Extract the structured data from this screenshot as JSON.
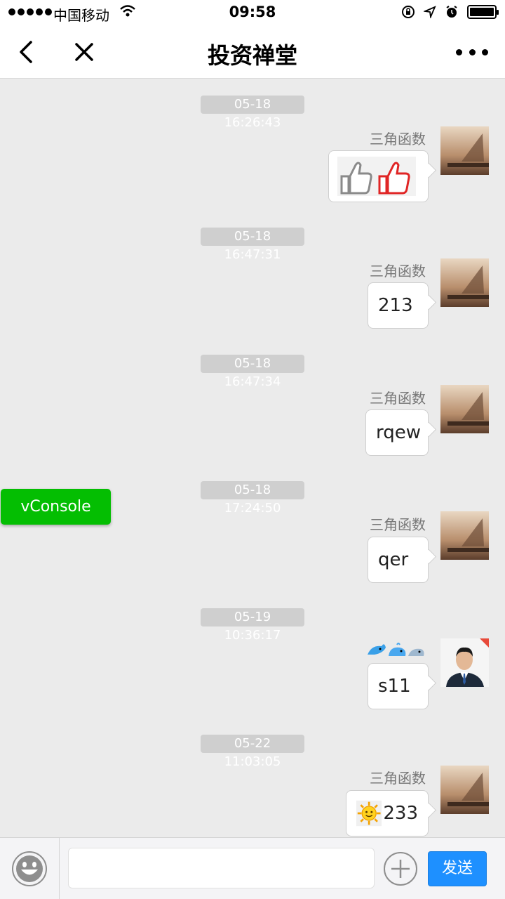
{
  "status_bar": {
    "carrier": "中国移动",
    "time": "09:58"
  },
  "nav": {
    "title": "投资禅堂"
  },
  "messages": [
    {
      "time": "05-18 16:26:43",
      "sender": "三角函数",
      "content": "",
      "content_icon": "thumbs-up-icons"
    },
    {
      "time": "05-18 16:47:31",
      "sender": "三角函数",
      "content": "213"
    },
    {
      "time": "05-18 16:47:34",
      "sender": "三角函数",
      "content": "rqew"
    },
    {
      "time": "05-18 17:24:50",
      "sender": "三角函数",
      "content": "qer"
    },
    {
      "time": "05-19 10:36:17",
      "sender": "",
      "sender_icons": "dolphin-whale-emoji-icons",
      "content": "s11"
    },
    {
      "time": "05-22 11:03:05",
      "sender": "三角函数",
      "content": "233",
      "content_icon": "sun-emoji-icon"
    }
  ],
  "vconsole": {
    "label": "vConsole"
  },
  "input_bar": {
    "placeholder": "",
    "send_label": "发送"
  },
  "colors": {
    "chat_bg": "#ebebeb",
    "vconsole_green": "#04be02",
    "send_blue": "#1e90ff",
    "time_chip": "#cfcfcf"
  }
}
